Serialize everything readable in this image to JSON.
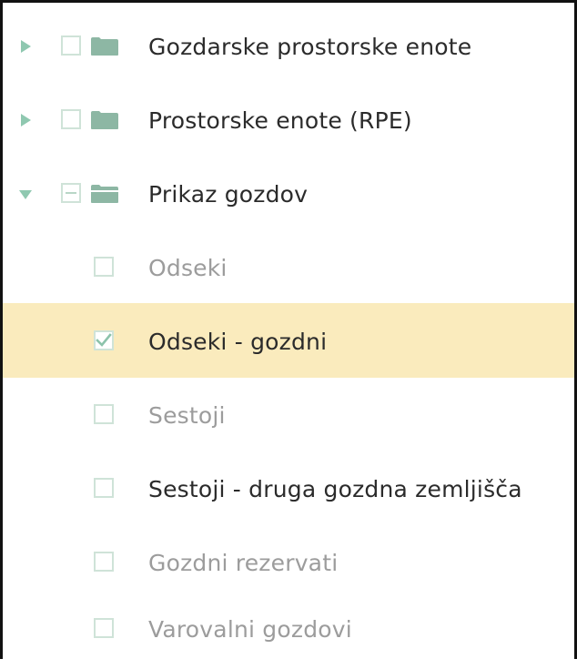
{
  "tree": {
    "groups": [
      {
        "label": "Gozdarske prostorske enote",
        "expanded": false,
        "check_state": "unchecked"
      },
      {
        "label": "Prostorske enote (RPE)",
        "expanded": false,
        "check_state": "unchecked"
      },
      {
        "label": "Prikaz gozdov",
        "expanded": true,
        "check_state": "partial"
      }
    ],
    "children": [
      {
        "label": "Odseki",
        "checked": false,
        "enabled": false
      },
      {
        "label": "Odseki - gozdni",
        "checked": true,
        "enabled": true,
        "selected": true
      },
      {
        "label": "Sestoji",
        "checked": false,
        "enabled": false
      },
      {
        "label": "Sestoji - druga gozdna zemljišča",
        "checked": false,
        "enabled": true
      },
      {
        "label": "Gozdni rezervati",
        "checked": false,
        "enabled": false
      },
      {
        "label": "Varovalni gozdovi",
        "checked": false,
        "enabled": false
      }
    ]
  },
  "colors": {
    "expander": "#8fc8b0",
    "folder": "#8db7a4",
    "checkbox_border": "#cfe3d8",
    "check_mark": "#8cc3ab",
    "selected_row_bg": "#faebbd",
    "text_enabled": "#2b2b2b",
    "text_disabled": "#9c9c9c"
  }
}
